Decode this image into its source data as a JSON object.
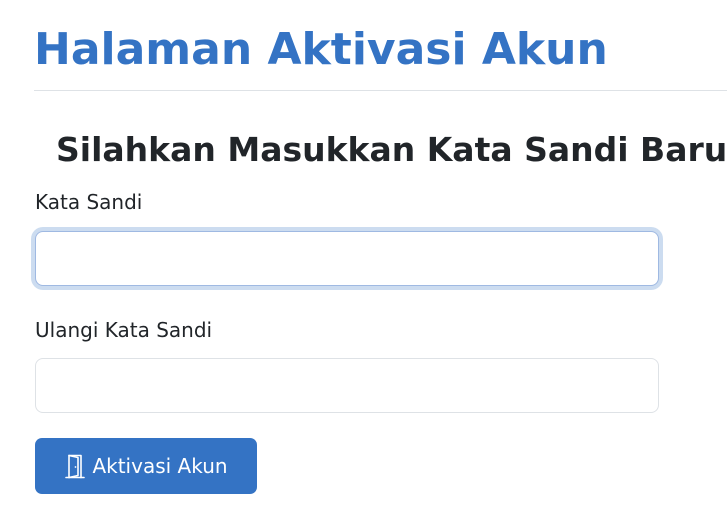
{
  "header": {
    "title": "Halaman Aktivasi Akun"
  },
  "form": {
    "heading": "Silahkan Masukkan Kata Sandi Baru",
    "password": {
      "label": "Kata Sandi",
      "value": ""
    },
    "confirm_password": {
      "label": "Ulangi Kata Sandi",
      "value": ""
    },
    "submit": {
      "label": "Aktivasi Akun",
      "icon": "door-open-icon"
    }
  },
  "colors": {
    "primary": "#3473c4",
    "text": "#212529",
    "border": "#dee2e6"
  }
}
